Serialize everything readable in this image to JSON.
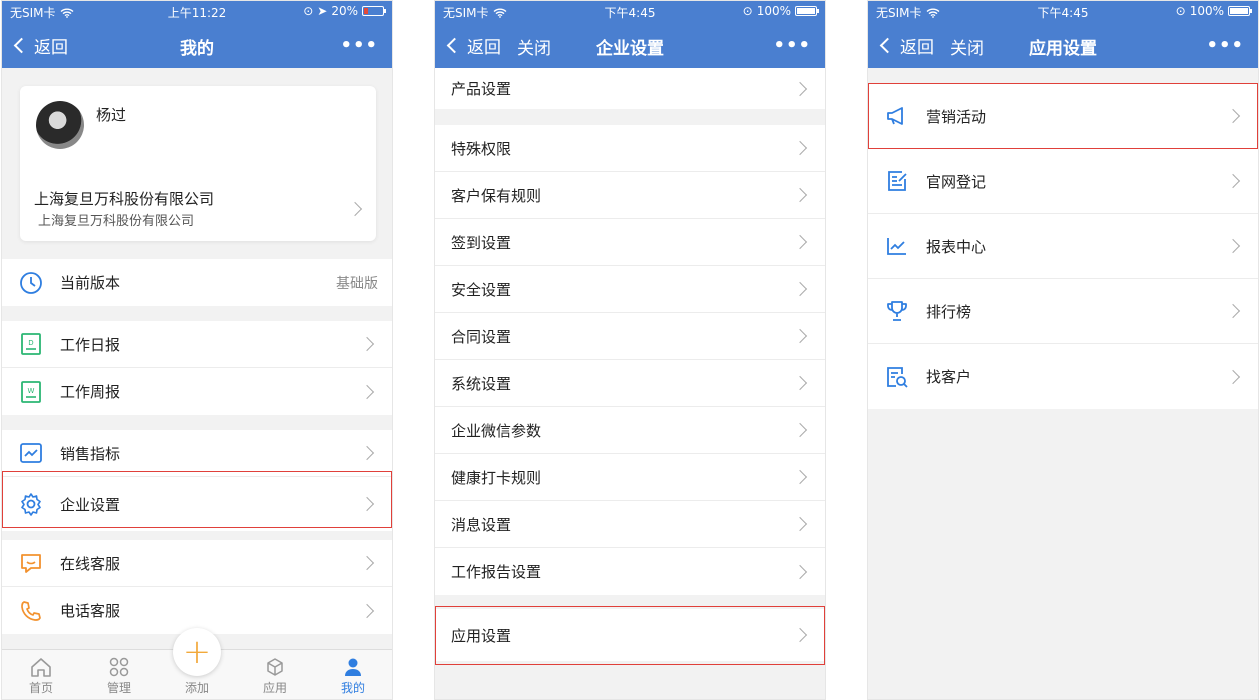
{
  "screen1": {
    "status": {
      "carrier": "无SIM卡",
      "time": "上午11:22",
      "battery": "20%"
    },
    "nav": {
      "back": "返回",
      "title": "我的",
      "more": "•••"
    },
    "profile": {
      "name": "杨过",
      "company": "上海复旦万科股份有限公司",
      "company_sub": "上海复旦万科股份有限公司"
    },
    "version": {
      "label": "当前版本",
      "value": "基础版"
    },
    "reports": [
      {
        "label": "工作日报",
        "icon": "daily-report-icon"
      },
      {
        "label": "工作周报",
        "icon": "weekly-report-icon"
      }
    ],
    "settings": [
      {
        "label": "销售指标",
        "icon": "chart-icon"
      },
      {
        "label": "企业设置",
        "icon": "gear-icon"
      }
    ],
    "service": [
      {
        "label": "在线客服",
        "icon": "chat-icon"
      },
      {
        "label": "电话客服",
        "icon": "phone-icon"
      }
    ],
    "tabs": [
      {
        "label": "首页",
        "icon": "home-icon"
      },
      {
        "label": "管理",
        "icon": "grid-icon"
      },
      {
        "label": "添加",
        "icon": "plus-icon"
      },
      {
        "label": "应用",
        "icon": "cube-icon"
      },
      {
        "label": "我的",
        "icon": "user-icon"
      }
    ]
  },
  "screen2": {
    "status": {
      "carrier": "无SIM卡",
      "time": "下午4:45",
      "battery": "100%"
    },
    "nav": {
      "back": "返回",
      "close": "关闭",
      "title": "企业设置",
      "more": "•••"
    },
    "top_item": "产品设置",
    "items": [
      "特殊权限",
      "客户保有规则",
      "签到设置",
      "安全设置",
      "合同设置",
      "系统设置",
      "企业微信参数",
      "健康打卡规则",
      "消息设置",
      "工作报告设置"
    ],
    "bottom_item": "应用设置"
  },
  "screen3": {
    "status": {
      "carrier": "无SIM卡",
      "time": "下午4:45",
      "battery": "100%"
    },
    "nav": {
      "back": "返回",
      "close": "关闭",
      "title": "应用设置",
      "more": "•••"
    },
    "items": [
      {
        "label": "营销活动",
        "icon": "megaphone-icon"
      },
      {
        "label": "官网登记",
        "icon": "register-icon"
      },
      {
        "label": "报表中心",
        "icon": "chart-icon"
      },
      {
        "label": "排行榜",
        "icon": "trophy-icon"
      },
      {
        "label": "找客户",
        "icon": "search-doc-icon"
      }
    ]
  }
}
